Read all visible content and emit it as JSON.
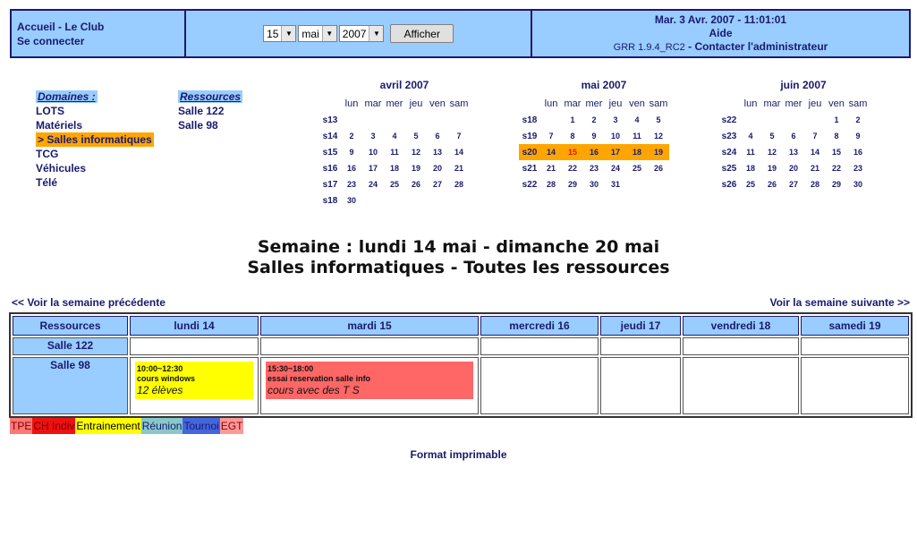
{
  "header": {
    "home_link": "Accueil - Le Club",
    "login_link": "Se connecter",
    "day_select": "15",
    "month_select": "mai",
    "year_select": "2007",
    "show_button": "Afficher",
    "datetime": "Mar. 3 Avr. 2007 - 11:01:01",
    "help_link": "Aide",
    "version": "GRR 1.9.4_RC2",
    "contact_link": "Contacter l'administrateur"
  },
  "domains": {
    "title": "Domaines :",
    "items": [
      "LOTS",
      "Matériels",
      "> Salles informatiques",
      "TCG",
      "Véhicules",
      "Télé"
    ]
  },
  "resources": {
    "title": "Ressources",
    "items": [
      "Salle 122",
      "Salle 98"
    ]
  },
  "calendars": [
    {
      "title": "avril 2007",
      "headers": [
        "lun",
        "mar",
        "mer",
        "jeu",
        "ven",
        "sam"
      ],
      "weeks": [
        {
          "w": "s13",
          "d": [
            "",
            "",
            "",
            "",
            "",
            ""
          ]
        },
        {
          "w": "s14",
          "d": [
            "2",
            "3",
            "4",
            "5",
            "6",
            "7"
          ]
        },
        {
          "w": "s15",
          "d": [
            "9",
            "10",
            "11",
            "12",
            "13",
            "14"
          ]
        },
        {
          "w": "s16",
          "d": [
            "16",
            "17",
            "18",
            "19",
            "20",
            "21"
          ]
        },
        {
          "w": "s17",
          "d": [
            "23",
            "24",
            "25",
            "26",
            "27",
            "28"
          ]
        },
        {
          "w": "s18",
          "d": [
            "30",
            "",
            "",
            "",
            "",
            ""
          ]
        }
      ]
    },
    {
      "title": "mai 2007",
      "headers": [
        "lun",
        "mar",
        "mer",
        "jeu",
        "ven",
        "sam"
      ],
      "weeks": [
        {
          "w": "s18",
          "d": [
            "",
            "1",
            "2",
            "3",
            "4",
            "5"
          ]
        },
        {
          "w": "s19",
          "d": [
            "7",
            "8",
            "9",
            "10",
            "11",
            "12"
          ]
        },
        {
          "w": "s20",
          "d": [
            "14",
            "15",
            "16",
            "17",
            "18",
            "19"
          ]
        },
        {
          "w": "s21",
          "d": [
            "21",
            "22",
            "23",
            "24",
            "25",
            "26"
          ]
        },
        {
          "w": "s22",
          "d": [
            "28",
            "29",
            "30",
            "31",
            "",
            ""
          ]
        }
      ]
    },
    {
      "title": "juin 2007",
      "headers": [
        "lun",
        "mar",
        "mer",
        "jeu",
        "ven",
        "sam"
      ],
      "weeks": [
        {
          "w": "s22",
          "d": [
            "",
            "",
            "",
            "",
            "1",
            "2"
          ]
        },
        {
          "w": "s23",
          "d": [
            "4",
            "5",
            "6",
            "7",
            "8",
            "9"
          ]
        },
        {
          "w": "s24",
          "d": [
            "11",
            "12",
            "13",
            "14",
            "15",
            "16"
          ]
        },
        {
          "w": "s25",
          "d": [
            "18",
            "19",
            "20",
            "21",
            "22",
            "23"
          ]
        },
        {
          "w": "s26",
          "d": [
            "25",
            "26",
            "27",
            "28",
            "29",
            "30"
          ]
        }
      ]
    }
  ],
  "heading": {
    "line1": "Semaine : lundi 14 mai - dimanche 20 mai",
    "line2": "Salles informatiques - Toutes les ressources"
  },
  "nav": {
    "prev": "<< Voir la semaine précédente",
    "next": "Voir la semaine suivante >>"
  },
  "grid": {
    "columns": [
      "Ressources",
      "lundi 14",
      "mardi 15",
      "mercredi 16",
      "jeudi 17",
      "vendredi 18",
      "samedi 19"
    ],
    "rows": [
      {
        "resource": "Salle 122"
      },
      {
        "resource": "Salle 98"
      }
    ],
    "events": [
      {
        "time": "10:00~12:30",
        "title": "cours windows",
        "desc": "12 élèves",
        "color": "#ffff00"
      },
      {
        "time": "15:30~18:00",
        "title": "essai reservation salle info",
        "desc": "cours avec des T S",
        "color": "#ff6666"
      }
    ]
  },
  "legend": [
    {
      "label": "TPE",
      "bg": "#ff7777",
      "fg": "#800000"
    },
    {
      "label": "CH Indiv",
      "bg": "#ee1111",
      "fg": "#800000"
    },
    {
      "label": "Entrainement",
      "bg": "#ffff00",
      "fg": "#000000"
    },
    {
      "label": "Réunion",
      "bg": "#88c8c8",
      "fg": "#1a1a6e"
    },
    {
      "label": "Tournoi",
      "bg": "#4466dd",
      "fg": "#1a1a6e"
    },
    {
      "label": "EGT",
      "bg": "#ff9999",
      "fg": "#800000"
    }
  ],
  "footer": {
    "print_link": "Format imprimable"
  },
  "colors": {
    "header_bg": "#99ccff",
    "accent": "#1a1a6e",
    "highlight": "#ffa500"
  }
}
